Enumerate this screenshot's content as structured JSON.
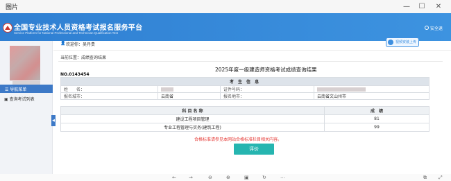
{
  "window": {
    "title": "图片",
    "controls": [
      "—",
      "☐",
      "✕"
    ]
  },
  "header": {
    "title": "全国专业技术人员资格考试报名服务平台",
    "subtitle": "Service Platform for National Professional and Technician Qualification Test",
    "exit_label": "安全退"
  },
  "topbar": {
    "welcome": "欢迎你：吴丹贵",
    "upload_label": "视频安装上传"
  },
  "sidebar": {
    "nav_menu": "导航菜单",
    "items": [
      "查询考试列表"
    ],
    "collapse": "◀"
  },
  "breadcrumb": "当前位置：成绩查询结果",
  "page": {
    "title": "2025年度一级建造师资格考试成绩查询结果",
    "cert_no": "NO.0143454"
  },
  "candidate": {
    "section_title": "考 生 信 息",
    "name_label": "姓　　名：",
    "id_label": "证件号码：",
    "city_label": "报名城市：",
    "city_value": "云南省",
    "area_label": "报名地市：",
    "area_value": "云南省文山州市"
  },
  "scores": {
    "col_subject": "科 目 名 称",
    "col_score": "成　绩",
    "rows": [
      {
        "subject": "建设工程项目管理",
        "score": "81"
      },
      {
        "subject": "专业工程管理与实务(建筑工程)",
        "score": "99"
      }
    ]
  },
  "notice": "合格标准请参见本网站合格标准栏目相关内容。",
  "evaluate_button": "评价",
  "colors": {
    "header": "#2f7fd2",
    "nav": "#3d79c7",
    "button": "#26b5b0",
    "notice": "#e53935"
  },
  "toolbar_icons": [
    "first-page-icon",
    "prev-icon",
    "zoom-out-icon",
    "zoom-in-icon",
    "fit-icon",
    "rotate-icon",
    "next-icon",
    "more-icon"
  ]
}
